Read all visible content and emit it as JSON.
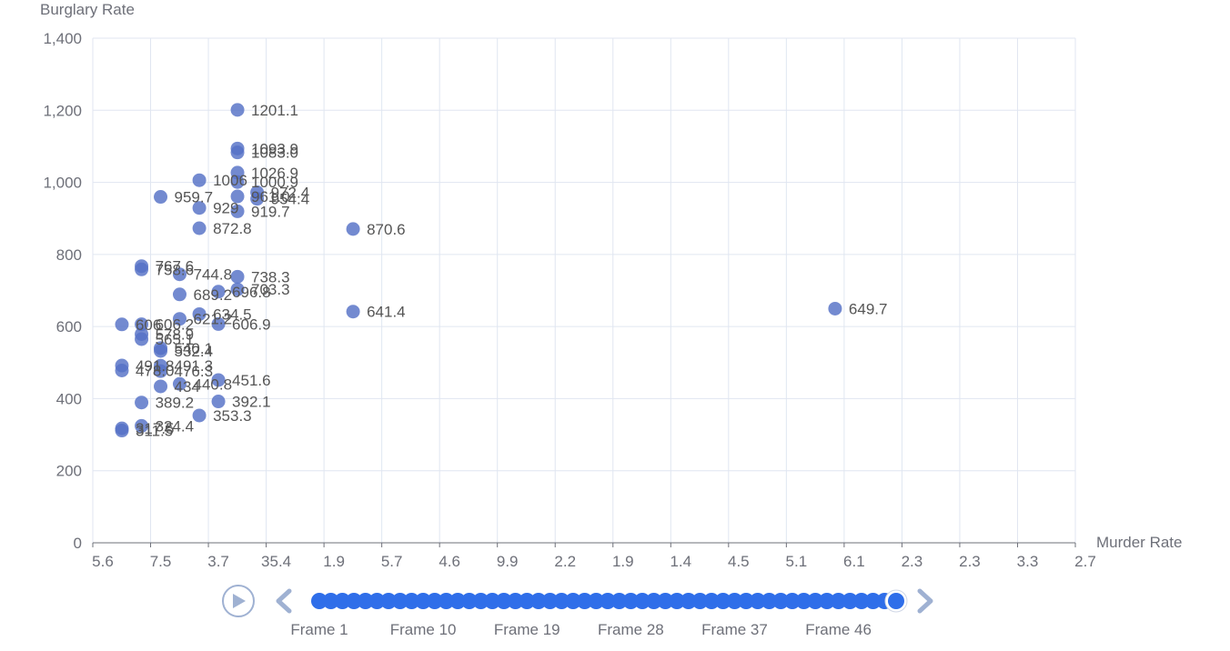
{
  "chart_data": {
    "type": "scatter",
    "ylabel": "Burglary Rate",
    "xlabel": "Murder Rate",
    "ylim": [
      0,
      1400
    ],
    "yticks": [
      0,
      200,
      400,
      600,
      800,
      1000,
      1200,
      1400
    ],
    "ytick_labels": [
      "0",
      "200",
      "400",
      "600",
      "800",
      "1,000",
      "1,200",
      "1,400"
    ],
    "x_categories": [
      "5.6",
      "7.5",
      "3.7",
      "35.4",
      "1.9",
      "5.7",
      "4.6",
      "9.9",
      "2.2",
      "1.9",
      "1.4",
      "4.5",
      "5.1",
      "6.1",
      "2.3",
      "2.3",
      "3.3",
      "2.7"
    ],
    "grid": true,
    "series": [
      {
        "points": [
          {
            "x": 0.33,
            "y": 1201.1,
            "label": "1201.1"
          },
          {
            "x": 0.33,
            "y": 1093.9,
            "label": "1093.9"
          },
          {
            "x": 0.33,
            "y": 1083.0,
            "label": "1083.0"
          },
          {
            "x": 0.33,
            "y": 1026.9,
            "label": "1026.9"
          },
          {
            "x": 0.33,
            "y": 1000.9,
            "label": "1000.9"
          },
          {
            "x": -0.33,
            "y": 1006.0,
            "label": "1006"
          },
          {
            "x": 0.67,
            "y": 972.4,
            "label": "972.4"
          },
          {
            "x": 0.33,
            "y": 961.0,
            "label": "961.0"
          },
          {
            "x": -1.0,
            "y": 959.7,
            "label": "959.7"
          },
          {
            "x": 0.67,
            "y": 954.4,
            "label": "954.4"
          },
          {
            "x": -0.33,
            "y": 929.0,
            "label": "929"
          },
          {
            "x": 0.33,
            "y": 919.7,
            "label": "919.7"
          },
          {
            "x": -0.33,
            "y": 872.8,
            "label": "872.8"
          },
          {
            "x": 2.33,
            "y": 870.6,
            "label": "870.6"
          },
          {
            "x": -1.33,
            "y": 767.6,
            "label": "767.6"
          },
          {
            "x": -1.33,
            "y": 758.6,
            "label": "758.6"
          },
          {
            "x": -0.67,
            "y": 744.8,
            "label": "744.8"
          },
          {
            "x": 0.33,
            "y": 738.3,
            "label": "738.3"
          },
          {
            "x": 0.33,
            "y": 703.3,
            "label": "703.3"
          },
          {
            "x": 0.0,
            "y": 696.8,
            "label": "696.8"
          },
          {
            "x": -0.67,
            "y": 689.2,
            "label": "689.2"
          },
          {
            "x": 2.33,
            "y": 641.4,
            "label": "641.4"
          },
          {
            "x": 10.67,
            "y": 649.7,
            "label": "649.7"
          },
          {
            "x": -0.33,
            "y": 634.5,
            "label": "634.5"
          },
          {
            "x": -0.67,
            "y": 621.2,
            "label": "621.2"
          },
          {
            "x": 0.0,
            "y": 606.9,
            "label": "606.9"
          },
          {
            "x": -1.67,
            "y": 606.0,
            "label": "606"
          },
          {
            "x": -1.33,
            "y": 606.2,
            "label": "606.2"
          },
          {
            "x": -1.33,
            "y": 578.9,
            "label": "578.9"
          },
          {
            "x": -1.33,
            "y": 565.1,
            "label": "565.1"
          },
          {
            "x": -1.0,
            "y": 540.1,
            "label": "540.1"
          },
          {
            "x": -1.0,
            "y": 532.4,
            "label": "532.4"
          },
          {
            "x": -1.67,
            "y": 491.8,
            "label": "491.8"
          },
          {
            "x": -1.0,
            "y": 491.3,
            "label": "491.3"
          },
          {
            "x": -1.67,
            "y": 478.0,
            "label": "478.0"
          },
          {
            "x": -1.0,
            "y": 476.3,
            "label": "476.3"
          },
          {
            "x": 0.0,
            "y": 451.6,
            "label": "451.6"
          },
          {
            "x": -1.0,
            "y": 434.0,
            "label": "434"
          },
          {
            "x": -0.67,
            "y": 440.8,
            "label": "440.8"
          },
          {
            "x": -1.33,
            "y": 389.2,
            "label": "389.2"
          },
          {
            "x": 0.0,
            "y": 392.1,
            "label": "392.1"
          },
          {
            "x": -0.33,
            "y": 353.3,
            "label": "353.3"
          },
          {
            "x": -1.33,
            "y": 324.4,
            "label": "324.4"
          },
          {
            "x": -1.67,
            "y": 317.5,
            "label": "317.5"
          },
          {
            "x": -1.67,
            "y": 311.5,
            "label": "311.5"
          }
        ]
      }
    ]
  },
  "timeline": {
    "frame_count": 51,
    "current_frame": 51,
    "labels": [
      "Frame 1",
      "Frame 10",
      "Frame 19",
      "Frame 28",
      "Frame 37",
      "Frame 46"
    ],
    "label_frames": [
      1,
      10,
      19,
      28,
      37,
      46
    ]
  },
  "colors": {
    "point": "#5470c6",
    "axis": "#6e7079",
    "grid": "#e0e6f1",
    "text": "#6e7079",
    "label": "#555555",
    "timeline_dot": "#2f6ee9",
    "control": "#9fb1d2"
  },
  "icons": [
    "play-icon",
    "prev-arrow-icon",
    "next-arrow-icon"
  ]
}
